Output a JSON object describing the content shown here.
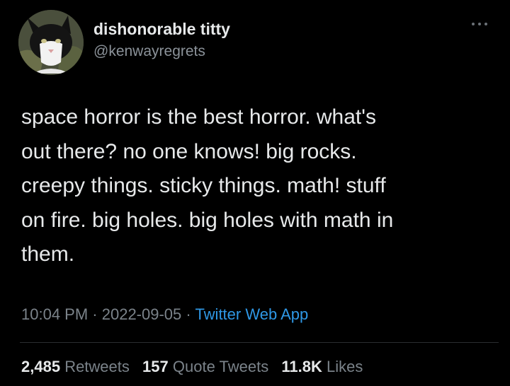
{
  "colors": {
    "background": "#000000",
    "text_primary": "#e7e9ea",
    "text_secondary": "#7b838a",
    "link": "#2f98e6"
  },
  "user": {
    "display_name": "dishonorable titty",
    "handle": "@kenwayregrets",
    "avatar_icon": "cat-avatar-icon"
  },
  "tweet": {
    "lines": [
      "space horror is the best horror. what's",
      "out there? no one knows! big rocks.",
      "creepy things. sticky things. math! stuff",
      "on fire. big holes. big holes with math in",
      "them."
    ],
    "time": "10:04 PM",
    "date": "2022-09-05",
    "separator": " · ",
    "source": "Twitter Web App"
  },
  "stats": {
    "retweets": {
      "count": "2,485",
      "label": "Retweets"
    },
    "quote_tweets": {
      "count": "157",
      "label": "Quote Tweets"
    },
    "likes": {
      "count": "11.8K",
      "label": "Likes"
    }
  },
  "icons": {
    "more": "more-options-icon"
  }
}
